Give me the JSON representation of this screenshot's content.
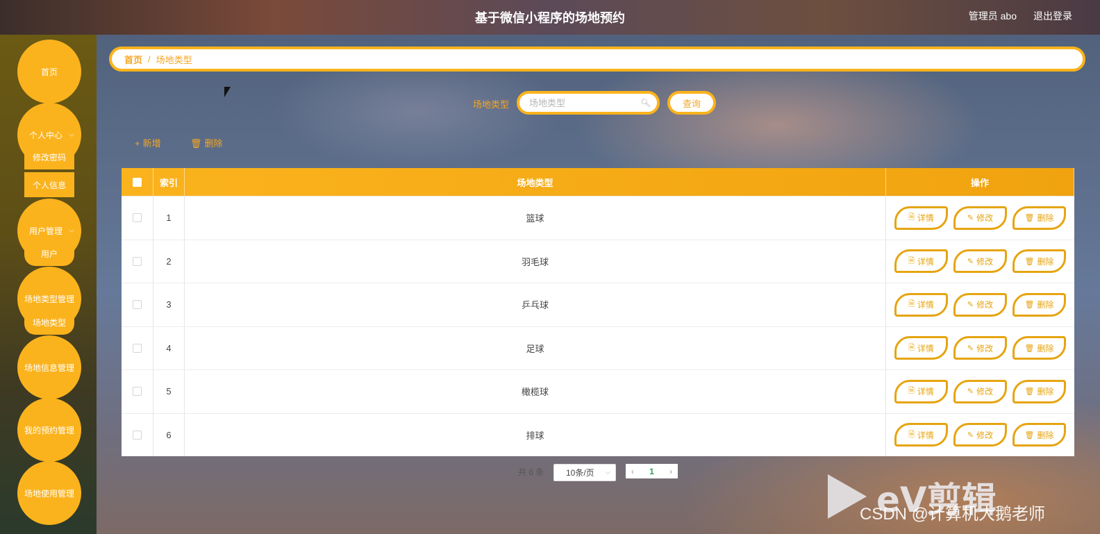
{
  "header": {
    "title": "基于微信小程序的场地预约",
    "user": "管理员 abo",
    "logout": "退出登录"
  },
  "sidebar": {
    "items": [
      {
        "label": "首页"
      },
      {
        "label": "个人中心",
        "children": [
          "修改密码",
          "个人信息"
        ]
      },
      {
        "label": "用户管理",
        "children": [
          "用户"
        ]
      },
      {
        "label": "场地类型管理",
        "children": [
          "场地类型"
        ]
      },
      {
        "label": "场地信息管理"
      },
      {
        "label": "我的预约管理"
      },
      {
        "label": "场地使用管理"
      }
    ]
  },
  "breadcrumb": {
    "home": "首页",
    "separator": "/",
    "current": "场地类型"
  },
  "search": {
    "label": "场地类型",
    "placeholder": "场地类型",
    "value": "",
    "button": "查询"
  },
  "actions": {
    "add": "新增",
    "delete": "删除"
  },
  "table": {
    "headers": {
      "index": "索引",
      "name": "场地类型",
      "ops": "操作"
    },
    "op_labels": {
      "detail": "详情",
      "edit": "修改",
      "delete": "删除"
    },
    "rows": [
      {
        "index": "1",
        "name": "篮球"
      },
      {
        "index": "2",
        "name": "羽毛球"
      },
      {
        "index": "3",
        "name": "乒乓球"
      },
      {
        "index": "4",
        "name": "足球"
      },
      {
        "index": "5",
        "name": "橄榄球"
      },
      {
        "index": "6",
        "name": "排球"
      }
    ]
  },
  "pagination": {
    "total": "共 6 条",
    "page_size": "10条/页",
    "current_page": "1"
  },
  "watermark": {
    "logo_text": "eV剪辑",
    "credit": "CSDN @计算机大鹅老师"
  },
  "colors": {
    "accent": "#fbb31d",
    "button_border": "#e6a410"
  }
}
